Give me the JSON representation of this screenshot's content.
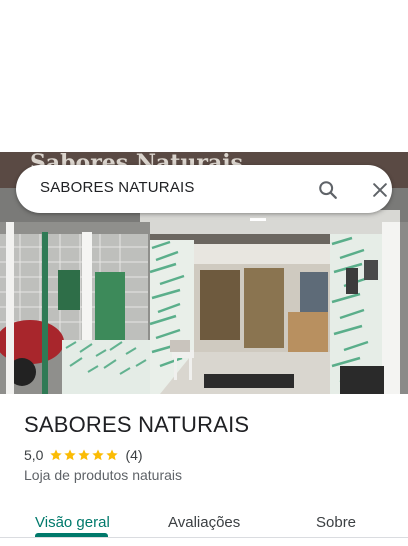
{
  "search": {
    "query": "SABORES NATURAIS",
    "search_icon": "search-icon",
    "close_icon": "close-icon"
  },
  "hero": {
    "storefront_sign": "Sabores Naturais"
  },
  "place": {
    "name": "SABORES NATURAIS",
    "rating": "5,0",
    "stars_filled": 5,
    "stars_total": 5,
    "review_count": "(4)",
    "category": "Loja de produtos naturais"
  },
  "tabs": [
    {
      "label": "Visão geral",
      "active": true
    },
    {
      "label": "Avaliações",
      "active": false
    },
    {
      "label": "Sobre",
      "active": false
    }
  ],
  "colors": {
    "accent": "#00796b",
    "star": "#fbbc04",
    "text_primary": "#202124",
    "text_secondary": "#5f6368"
  }
}
